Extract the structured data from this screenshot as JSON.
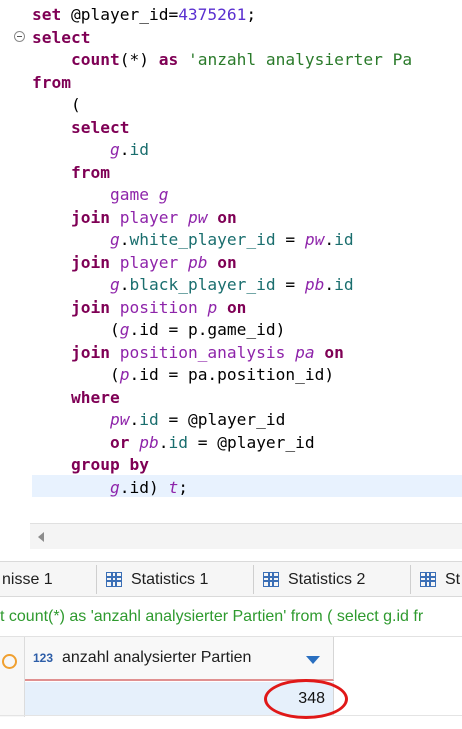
{
  "editor": {
    "lines": [
      [
        [
          "kw-plain",
          "set "
        ],
        [
          "plain",
          "@player_id="
        ],
        [
          "num",
          "4375261"
        ],
        [
          "plain",
          ";"
        ]
      ],
      [
        [
          "kw",
          "select"
        ]
      ],
      [
        [
          "plain",
          "    "
        ],
        [
          "kwb",
          "count"
        ],
        [
          "plain",
          "(*) "
        ],
        [
          "kw",
          "as"
        ],
        [
          "plain",
          " "
        ],
        [
          "str",
          "'anzahl analysierter Pa"
        ]
      ],
      [
        [
          "kw",
          "from"
        ]
      ],
      [
        [
          "plain",
          "    ("
        ]
      ],
      [
        [
          "plain",
          "    "
        ],
        [
          "kw",
          "select"
        ]
      ],
      [
        [
          "plain",
          "        "
        ],
        [
          "alias",
          "g"
        ],
        [
          "plain",
          "."
        ],
        [
          "ident",
          "id"
        ]
      ],
      [
        [
          "plain",
          "    "
        ],
        [
          "kw",
          "from"
        ]
      ],
      [
        [
          "plain",
          "        "
        ],
        [
          "tbl",
          "game "
        ],
        [
          "alias",
          "g"
        ]
      ],
      [
        [
          "plain",
          "    "
        ],
        [
          "kw",
          "join"
        ],
        [
          "plain",
          " "
        ],
        [
          "tbl",
          "player "
        ],
        [
          "alias",
          "pw"
        ],
        [
          "plain",
          " "
        ],
        [
          "kw",
          "on"
        ]
      ],
      [
        [
          "plain",
          "        "
        ],
        [
          "alias",
          "g"
        ],
        [
          "plain",
          "."
        ],
        [
          "ident",
          "white_player_id"
        ],
        [
          "plain",
          " = "
        ],
        [
          "alias",
          "pw"
        ],
        [
          "plain",
          "."
        ],
        [
          "ident",
          "id"
        ]
      ],
      [
        [
          "plain",
          "    "
        ],
        [
          "kw",
          "join"
        ],
        [
          "plain",
          " "
        ],
        [
          "tbl",
          "player "
        ],
        [
          "alias",
          "pb"
        ],
        [
          "plain",
          " "
        ],
        [
          "kw",
          "on"
        ]
      ],
      [
        [
          "plain",
          "        "
        ],
        [
          "alias",
          "g"
        ],
        [
          "plain",
          "."
        ],
        [
          "ident",
          "black_player_id"
        ],
        [
          "plain",
          " = "
        ],
        [
          "alias",
          "pb"
        ],
        [
          "plain",
          "."
        ],
        [
          "ident",
          "id"
        ]
      ],
      [
        [
          "plain",
          "    "
        ],
        [
          "kw",
          "join"
        ],
        [
          "plain",
          " "
        ],
        [
          "tbl",
          "position "
        ],
        [
          "alias",
          "p"
        ],
        [
          "plain",
          " "
        ],
        [
          "kw",
          "on"
        ]
      ],
      [
        [
          "plain",
          "        ("
        ],
        [
          "alias",
          "g"
        ],
        [
          "plain",
          ".id = p.game_id)"
        ]
      ],
      [
        [
          "plain",
          "    "
        ],
        [
          "kw",
          "join"
        ],
        [
          "plain",
          " "
        ],
        [
          "tbl",
          "position_analysis "
        ],
        [
          "alias",
          "pa"
        ],
        [
          "plain",
          " "
        ],
        [
          "kw",
          "on"
        ]
      ],
      [
        [
          "plain",
          "        ("
        ],
        [
          "alias",
          "p"
        ],
        [
          "plain",
          ".id = pa.position_id)"
        ]
      ],
      [
        [
          "plain",
          "    "
        ],
        [
          "kw",
          "where"
        ]
      ],
      [
        [
          "plain",
          "        "
        ],
        [
          "alias",
          "pw"
        ],
        [
          "plain",
          "."
        ],
        [
          "ident",
          "id"
        ],
        [
          "plain",
          " = @player_id"
        ]
      ],
      [
        [
          "plain",
          "        "
        ],
        [
          "kw",
          "or"
        ],
        [
          "plain",
          " "
        ],
        [
          "alias",
          "pb"
        ],
        [
          "plain",
          "."
        ],
        [
          "ident",
          "id"
        ],
        [
          "plain",
          " = @player_id"
        ]
      ],
      [
        [
          "plain",
          "    "
        ],
        [
          "kw",
          "group by"
        ]
      ],
      [
        [
          "plain",
          "        "
        ],
        [
          "alias",
          "g"
        ],
        [
          "plain",
          ".id) "
        ],
        [
          "alias",
          "t"
        ],
        [
          "plain",
          ";"
        ]
      ]
    ]
  },
  "tabs": [
    {
      "label": "nisse 1",
      "icon": ""
    },
    {
      "label": "Statistics 1",
      "icon": "grid-icon"
    },
    {
      "label": "Statistics 2",
      "icon": "grid-icon"
    },
    {
      "label": "St",
      "icon": "grid-icon"
    }
  ],
  "query_echo": "t count(*) as 'anzahl analysierter Partien' from ( select g.id fr",
  "result": {
    "column_type_icon": "123",
    "column_name": "anzahl analysierter Partien",
    "value": "348"
  },
  "colors": {
    "keyword": "#7f0055",
    "string": "#2a7a2a",
    "number": "#5a2fd0",
    "alias": "#8e24aa",
    "highlight_ring": "#e01818"
  }
}
